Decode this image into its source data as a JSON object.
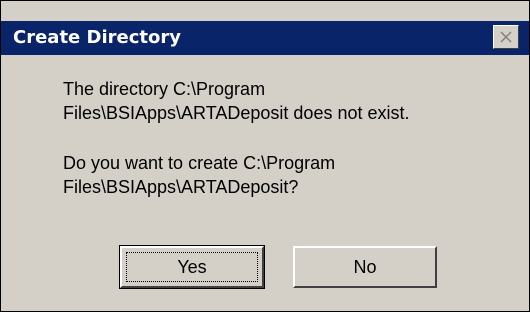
{
  "window": {
    "title": "Create Directory",
    "close_icon": "close-icon"
  },
  "message": {
    "line1_a": "The directory C:\\Program",
    "line1_b": "Files\\BSIApps\\ARTADeposit does not exist.",
    "line2_a": "Do you want to create C:\\Program",
    "line2_b": "Files\\BSIApps\\ARTADeposit?"
  },
  "buttons": {
    "yes_label": "Yes",
    "no_label": "No"
  },
  "colors": {
    "titlebar": "#0a246a",
    "dialog_bg": "#d4d0c8",
    "title_text": "#ffffff"
  }
}
